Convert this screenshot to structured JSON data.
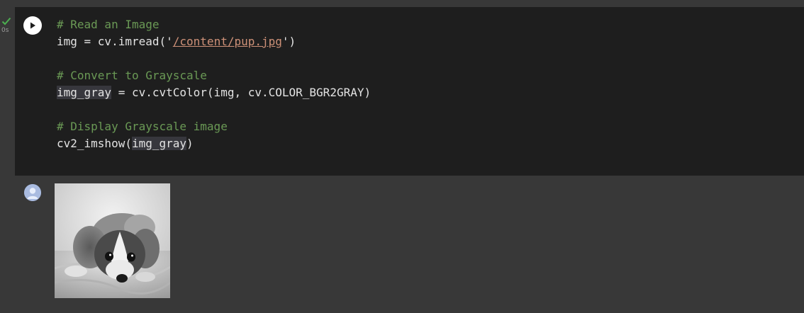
{
  "cell": {
    "status": "completed",
    "exec_time": "0s",
    "lines": [
      {
        "type": "comment",
        "text": "# Read an Image"
      },
      {
        "type": "code",
        "parts": [
          "img = cv.imread('",
          "/content/pup.jpg",
          "')"
        ]
      },
      {
        "type": "blank"
      },
      {
        "type": "comment",
        "text": "# Convert to Grayscale"
      },
      {
        "type": "code",
        "parts": [
          "img_gray",
          " = cv.cvtColor(img, cv.COLOR_BGR2GRAY)"
        ]
      },
      {
        "type": "blank"
      },
      {
        "type": "comment",
        "text": "# Display Grayscale image"
      },
      {
        "type": "code",
        "parts": [
          "cv2_imshow(",
          "img_gray",
          ")"
        ]
      }
    ]
  },
  "icons": {
    "status": "check-icon",
    "run": "play-icon",
    "output": "avatar-icon"
  },
  "output": {
    "image_subject": "grayscale puppy photo"
  },
  "colors": {
    "cell_bg": "#1e1e1e",
    "page_bg": "#383838",
    "comment": "#6a9955",
    "string": "#ce9178",
    "check": "#4caf50"
  }
}
